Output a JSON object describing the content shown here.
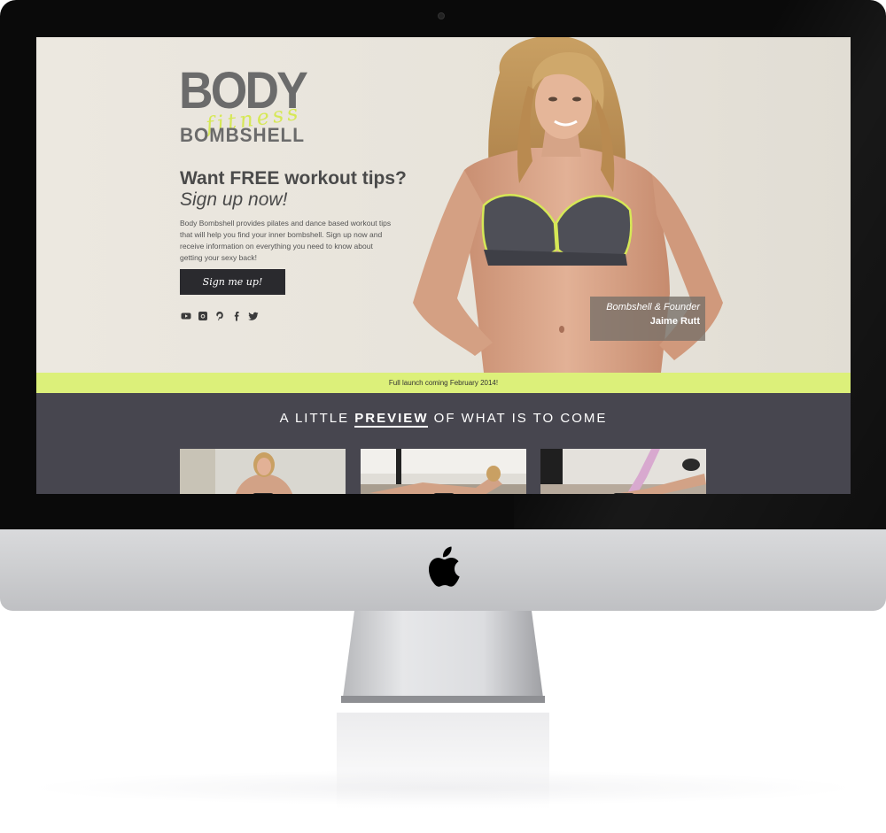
{
  "brand": {
    "logo_main": "BODY",
    "logo_script": "fitness",
    "logo_sub": "BOMBSHELL"
  },
  "hero": {
    "headline": "Want FREE workout tips?",
    "subheadline": "Sign up now!",
    "intro": "Body Bombshell provides pilates and dance based workout tips that will help you find your inner bombshell. Sign up now and receive information on everything you need to know about getting your sexy back!",
    "cta_label": "Sign me up!",
    "caption_role": "Bombshell & Founder",
    "caption_name": "Jaime Rutt"
  },
  "socials": [
    "youtube-icon",
    "instagram-icon",
    "pinterest-icon",
    "facebook-icon",
    "twitter-icon"
  ],
  "banner": {
    "text": "Full launch coming February 2014!"
  },
  "preview": {
    "title_pre": "A LITTLE",
    "title_highlight": "PREVIEW",
    "title_post": "OF WHAT IS TO COME"
  },
  "colors": {
    "accent": "#dcf07a",
    "dark": "#47464f",
    "button": "#2a2a2e"
  }
}
